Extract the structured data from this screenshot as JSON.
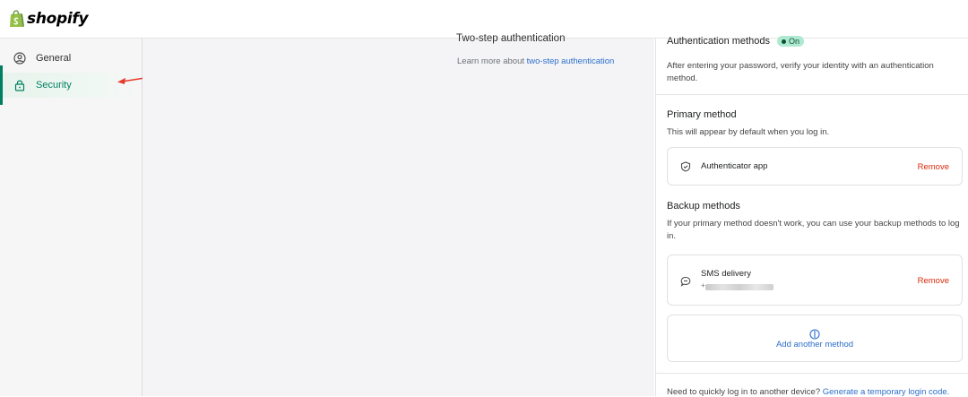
{
  "brand": {
    "name": "shopify",
    "color": "#95bf47"
  },
  "sidebar": {
    "items": [
      {
        "label": "General",
        "icon": "user-circle-icon",
        "active": false
      },
      {
        "label": "Security",
        "icon": "lock-icon",
        "active": true
      }
    ],
    "active_color": "#008060"
  },
  "section": {
    "title": "Two-step authentication",
    "desc_prefix": "Learn more about ",
    "desc_link": "two-step authentication"
  },
  "panel": {
    "auth_methods_title": "Authentication methods",
    "status_badge": "On",
    "auth_methods_desc": "After entering your password, verify your identity with an authentication method.",
    "primary": {
      "title": "Primary method",
      "desc": "This will appear by default when you log in.",
      "method": "Authenticator app",
      "method_icon": "shield-icon",
      "remove_label": "Remove"
    },
    "backup": {
      "title": "Backup methods",
      "desc": "If your primary method doesn't work, you can use your backup methods to log in.",
      "method": "SMS delivery",
      "method_icon": "chat-bubble-icon",
      "phone_prefix": "+",
      "remove_label": "Remove"
    },
    "add_method": {
      "label": "Add another method",
      "icon": "plus-circle-icon"
    },
    "footer_prefix": "Need to quickly log in to another device? ",
    "footer_link": "Generate a temporary login code."
  },
  "annotation": {
    "arrow_color": "#e8392b"
  }
}
